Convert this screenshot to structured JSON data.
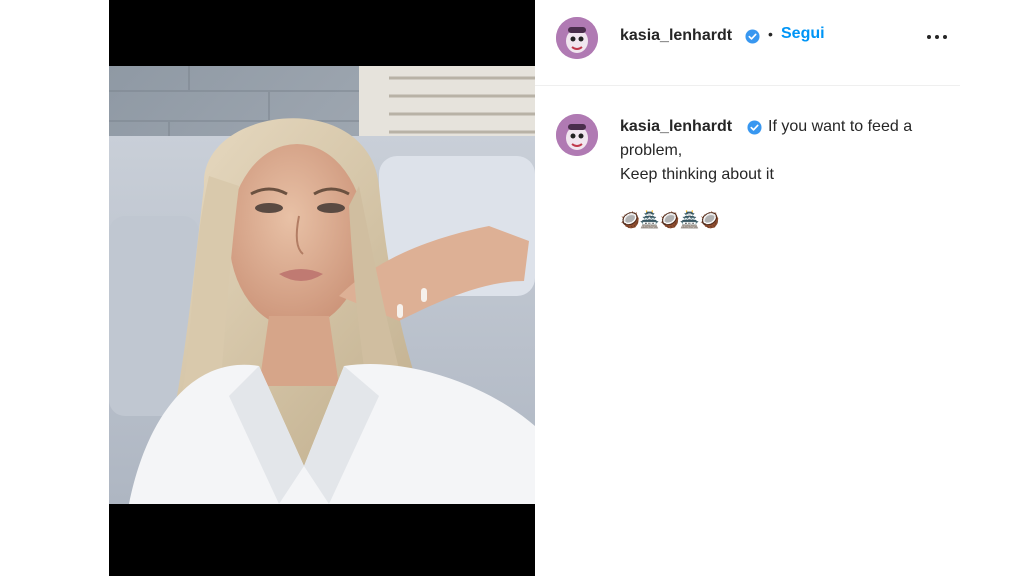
{
  "post": {
    "username": "kasia_lenhardt",
    "separator": "•",
    "follow_label": "Segui"
  },
  "caption": {
    "username": "kasia_lenhardt",
    "line1": "If you want to feed a",
    "line2": "problem,",
    "line3": "Keep thinking about it",
    "emojis": "🥥🏯🥥🏯🥥"
  },
  "colors": {
    "follow_blue": "#0095f6",
    "verified_blue": "#3897f0",
    "avatar_bg": "#b07ab3"
  },
  "icons": {
    "verified": "verified-badge-icon",
    "more": "more-options-icon"
  }
}
